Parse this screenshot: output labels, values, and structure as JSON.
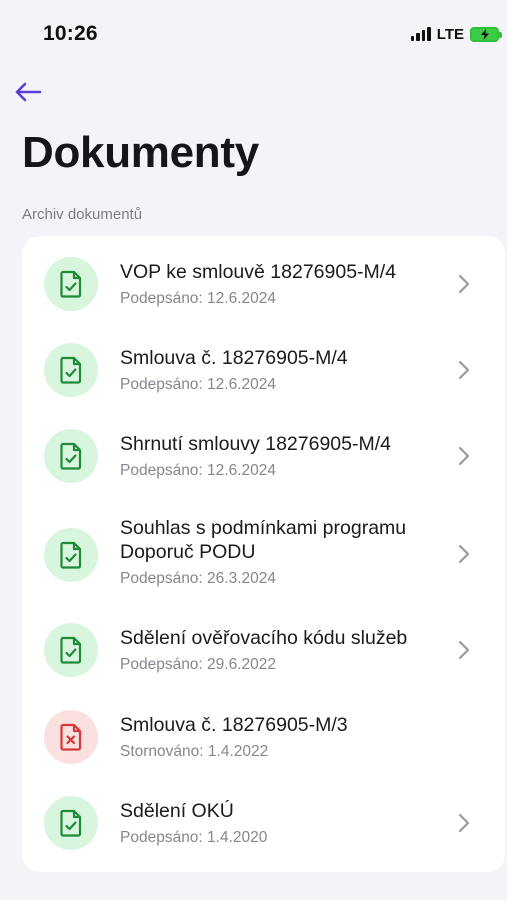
{
  "status_bar": {
    "time": "10:26",
    "network": "LTE",
    "battery_color": "#3ccb47"
  },
  "header": {
    "back_icon": "arrow-left-icon",
    "title": "Dokumenty",
    "section_label": "Archiv dokumentů"
  },
  "colors": {
    "accent": "#5b3fd9",
    "ok_bg": "#d8f5dd",
    "ok_fg": "#1f8a3a",
    "bad_bg": "#fbe0e0",
    "bad_fg": "#d23a3a"
  },
  "documents": [
    {
      "title": "VOP ke smlouvě 18276905-M/4",
      "subtitle": "Podepsáno: 12.6.2024",
      "status": "signed",
      "icon": "document-check-icon",
      "has_chevron": true
    },
    {
      "title": "Smlouva č. 18276905-M/4",
      "subtitle": "Podepsáno: 12.6.2024",
      "status": "signed",
      "icon": "document-check-icon",
      "has_chevron": true
    },
    {
      "title": "Shrnutí smlouvy 18276905-M/4",
      "subtitle": "Podepsáno: 12.6.2024",
      "status": "signed",
      "icon": "document-check-icon",
      "has_chevron": true
    },
    {
      "title_line1": "Souhlas s podmínkami programu",
      "title_line2": "Doporuč PODU",
      "subtitle": "Podepsáno: 26.3.2024",
      "status": "signed",
      "icon": "document-check-icon",
      "has_chevron": true
    },
    {
      "title": "Sdělení ověřovacího kódu služeb",
      "subtitle": "Podepsáno: 29.6.2022",
      "status": "signed",
      "icon": "document-check-icon",
      "has_chevron": true
    },
    {
      "title": "Smlouva č. 18276905-M/3",
      "subtitle": "Stornováno: 1.4.2022",
      "status": "cancelled",
      "icon": "document-x-icon",
      "has_chevron": false
    },
    {
      "title": "Sdělení OKÚ",
      "subtitle": "Podepsáno: 1.4.2020",
      "status": "signed",
      "icon": "document-check-icon",
      "has_chevron": true
    }
  ]
}
